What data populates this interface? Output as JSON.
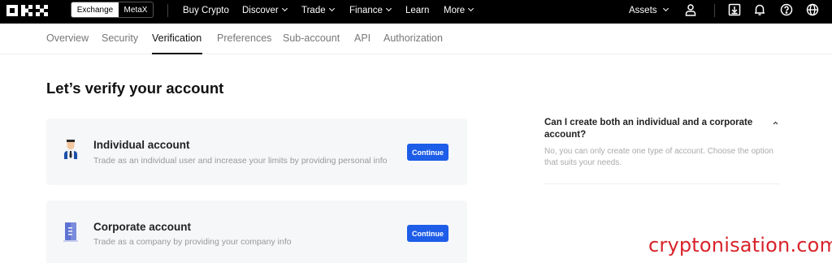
{
  "topbar": {
    "logo": "OKX",
    "mode_tabs": [
      "Exchange",
      "MetaX"
    ],
    "nav": [
      {
        "label": "Buy Crypto"
      },
      {
        "label": "Discover"
      },
      {
        "label": "Trade"
      },
      {
        "label": "Finance"
      },
      {
        "label": "Learn"
      },
      {
        "label": "More"
      }
    ],
    "assets_label": "Assets",
    "icons": [
      "user-icon",
      "download-icon",
      "bell-icon",
      "help-icon",
      "globe-icon"
    ]
  },
  "subnav": {
    "tabs": [
      "Overview",
      "Security",
      "Verification",
      "Preferences",
      "Sub-account",
      "API",
      "Authorization"
    ],
    "active": "Verification"
  },
  "main": {
    "title": "Let’s verify your account",
    "cards": [
      {
        "title": "Individual account",
        "desc": "Trade as an individual user and increase your limits by providing personal info",
        "button": "Continue",
        "icon": "person-icon"
      },
      {
        "title": "Corporate account",
        "desc": "Trade as a company by providing your company info",
        "button": "Continue",
        "icon": "building-icon"
      }
    ]
  },
  "faq": {
    "question": "Can I create both an individual and a corporate account?",
    "answer": "No, you can only create one type of account. Choose the option that suits your needs."
  },
  "watermark": "cryptonisation.com",
  "colors": {
    "topbar_bg": "#000000",
    "primary_button": "#1d5de8",
    "card_bg": "#f6f7f9",
    "watermark": "#d8232a"
  }
}
